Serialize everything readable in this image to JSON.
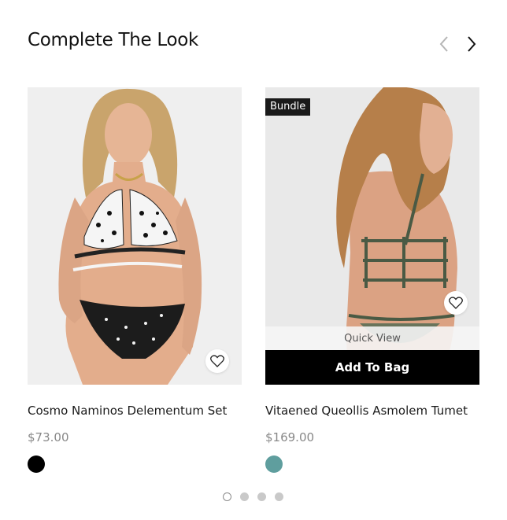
{
  "section": {
    "title": "Complete The Look"
  },
  "colors": {
    "badge_bg": "#1a1a1a",
    "add_to_bag_bg": "#000000",
    "price": "#888888"
  },
  "carousel": {
    "prev_icon": "chevron-left-icon",
    "next_icon": "chevron-right-icon",
    "pages": 4,
    "active_page": 1
  },
  "products": [
    {
      "name": "Cosmo Naminos Delementum Set",
      "price": "$73.00",
      "swatches": [
        "#000000"
      ],
      "wishlist_icon": "heart-icon"
    },
    {
      "name": "Vitaened Queollis Asmolem Tumet",
      "price": "$169.00",
      "badge": "Bundle",
      "quick_view_label": "Quick View",
      "add_to_bag_label": "Add To Bag",
      "swatches": [
        "#5f9e9e"
      ],
      "wishlist_icon": "heart-icon"
    }
  ]
}
